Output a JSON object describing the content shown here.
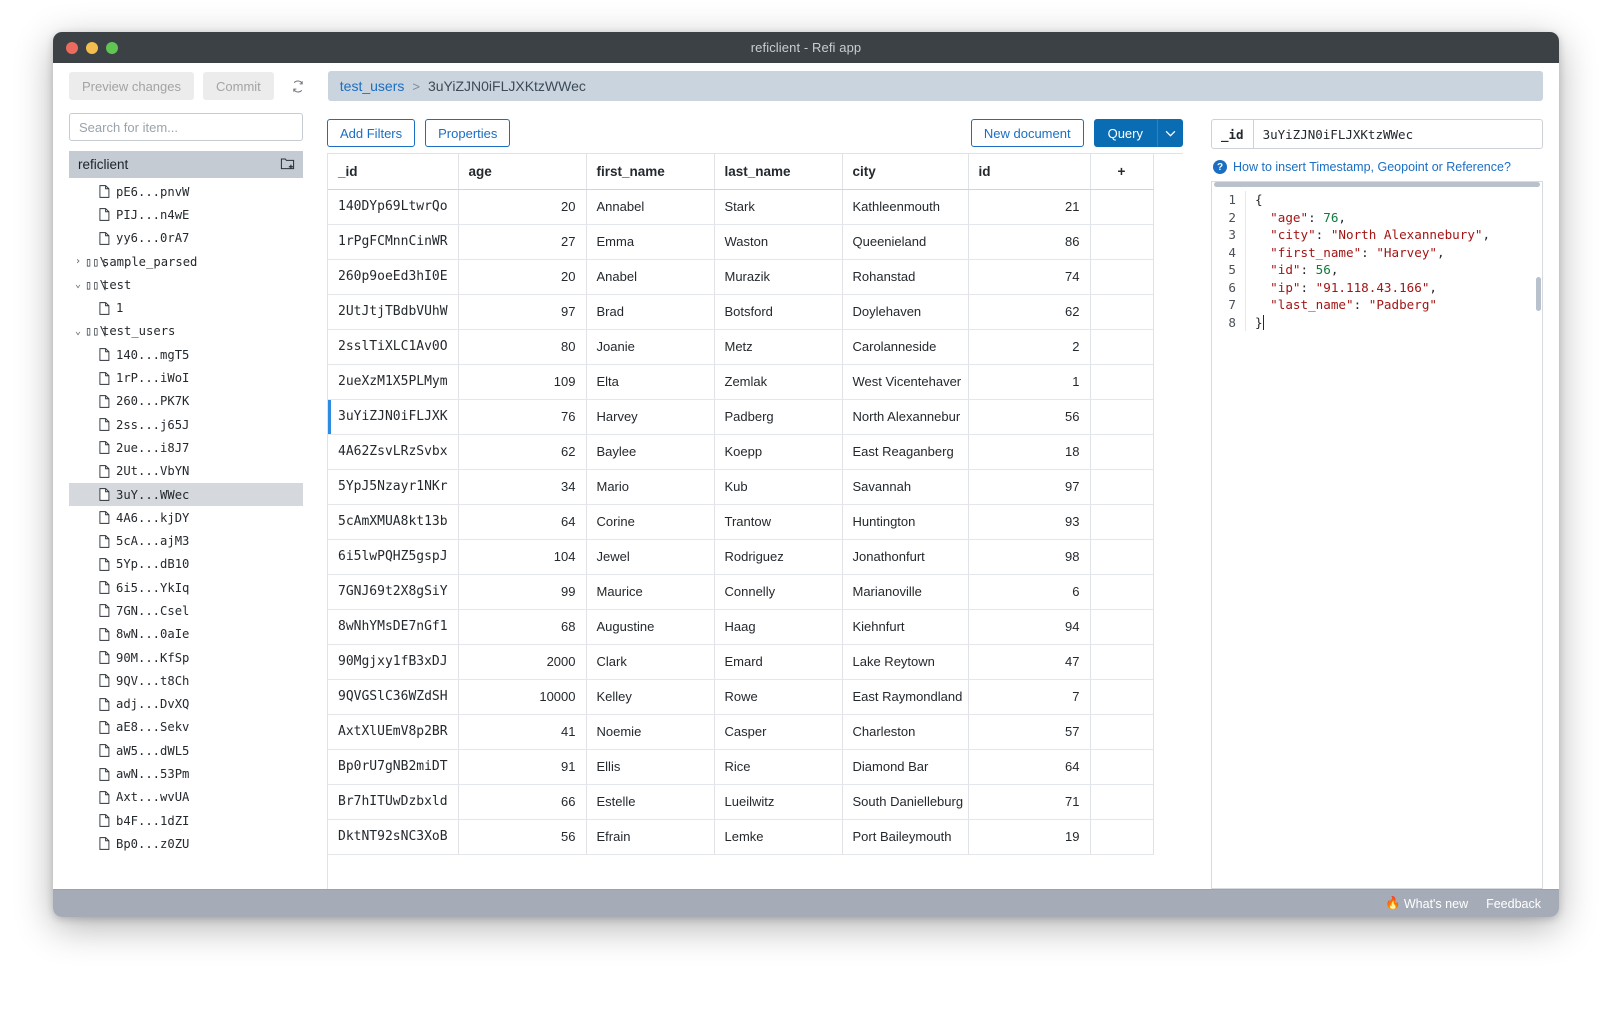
{
  "window": {
    "title": "reficlient - Refi app"
  },
  "toolbar": {
    "preview_changes_label": "Preview changes",
    "commit_label": "Commit",
    "refresh_icon": "refresh-icon",
    "breadcrumb": {
      "collection": "test_users",
      "separator": ">",
      "document": "3uYiZJN0iFLJXKtzWWec"
    }
  },
  "sidebar": {
    "search_placeholder": "Search for item...",
    "search_value": "",
    "header_label": "reficlient",
    "header_icon": "new-collection-icon",
    "items": [
      {
        "label": "pE6...pnvW",
        "type": "document",
        "indent": 1,
        "twisty": "",
        "selected": false
      },
      {
        "label": "PIJ...n4wE",
        "type": "document",
        "indent": 1,
        "twisty": "",
        "selected": false
      },
      {
        "label": "yy6...0rA7",
        "type": "document",
        "indent": 1,
        "twisty": "",
        "selected": false
      },
      {
        "label": "sample_parsed",
        "type": "collection",
        "indent": 0,
        "twisty": "collapsed",
        "selected": false
      },
      {
        "label": "test",
        "type": "collection",
        "indent": 0,
        "twisty": "expanded",
        "selected": false
      },
      {
        "label": "1",
        "type": "document",
        "indent": 1,
        "twisty": "",
        "selected": false
      },
      {
        "label": "test_users",
        "type": "collection",
        "indent": 0,
        "twisty": "expanded",
        "selected": false
      },
      {
        "label": "140...mgT5",
        "type": "document",
        "indent": 1,
        "twisty": "",
        "selected": false
      },
      {
        "label": "1rP...iWoI",
        "type": "document",
        "indent": 1,
        "twisty": "",
        "selected": false
      },
      {
        "label": "260...PK7K",
        "type": "document",
        "indent": 1,
        "twisty": "",
        "selected": false
      },
      {
        "label": "2ss...j65J",
        "type": "document",
        "indent": 1,
        "twisty": "",
        "selected": false
      },
      {
        "label": "2ue...i8J7",
        "type": "document",
        "indent": 1,
        "twisty": "",
        "selected": false
      },
      {
        "label": "2Ut...VbYN",
        "type": "document",
        "indent": 1,
        "twisty": "",
        "selected": false
      },
      {
        "label": "3uY...WWec",
        "type": "document",
        "indent": 1,
        "twisty": "",
        "selected": true
      },
      {
        "label": "4A6...kjDY",
        "type": "document",
        "indent": 1,
        "twisty": "",
        "selected": false
      },
      {
        "label": "5cA...ajM3",
        "type": "document",
        "indent": 1,
        "twisty": "",
        "selected": false
      },
      {
        "label": "5Yp...dB10",
        "type": "document",
        "indent": 1,
        "twisty": "",
        "selected": false
      },
      {
        "label": "6i5...YkIq",
        "type": "document",
        "indent": 1,
        "twisty": "",
        "selected": false
      },
      {
        "label": "7GN...Csel",
        "type": "document",
        "indent": 1,
        "twisty": "",
        "selected": false
      },
      {
        "label": "8wN...0aIe",
        "type": "document",
        "indent": 1,
        "twisty": "",
        "selected": false
      },
      {
        "label": "90M...KfSp",
        "type": "document",
        "indent": 1,
        "twisty": "",
        "selected": false
      },
      {
        "label": "9QV...t8Ch",
        "type": "document",
        "indent": 1,
        "twisty": "",
        "selected": false
      },
      {
        "label": "adj...DvXQ",
        "type": "document",
        "indent": 1,
        "twisty": "",
        "selected": false
      },
      {
        "label": "aE8...Sekv",
        "type": "document",
        "indent": 1,
        "twisty": "",
        "selected": false
      },
      {
        "label": "aW5...dWL5",
        "type": "document",
        "indent": 1,
        "twisty": "",
        "selected": false
      },
      {
        "label": "awN...53Pm",
        "type": "document",
        "indent": 1,
        "twisty": "",
        "selected": false
      },
      {
        "label": "Axt...wvUA",
        "type": "document",
        "indent": 1,
        "twisty": "",
        "selected": false
      },
      {
        "label": "b4F...1dZI",
        "type": "document",
        "indent": 1,
        "twisty": "",
        "selected": false
      },
      {
        "label": "Bp0...z0ZU",
        "type": "document",
        "indent": 1,
        "twisty": "",
        "selected": false
      }
    ]
  },
  "main": {
    "add_filters_label": "Add Filters",
    "properties_label": "Properties",
    "new_document_label": "New document",
    "query_label": "Query",
    "query_caret_icon": "chevron-down-icon",
    "add_column_icon": "plus-icon",
    "table": {
      "columns": [
        "_id",
        "age",
        "first_name",
        "last_name",
        "city",
        "id"
      ],
      "rows": [
        {
          "_id": "140DYp69LtwrQo",
          "age": "20",
          "first_name": "Annabel",
          "last_name": "Stark",
          "city": "Kathleenmouth",
          "id": "21",
          "selected": false
        },
        {
          "_id": "1rPgFCMnnCinWR",
          "age": "27",
          "first_name": "Emma",
          "last_name": "Waston",
          "city": "Queenieland",
          "id": "86",
          "selected": false
        },
        {
          "_id": "260p9oeEd3hI0E",
          "age": "20",
          "first_name": "Anabel",
          "last_name": "Murazik",
          "city": "Rohanstad",
          "id": "74",
          "selected": false
        },
        {
          "_id": "2UtJtjTBdbVUhW",
          "age": "97",
          "first_name": "Brad",
          "last_name": "Botsford",
          "city": "Doylehaven",
          "id": "62",
          "selected": false
        },
        {
          "_id": "2sslTiXLC1Av0O",
          "age": "80",
          "first_name": "Joanie",
          "last_name": "Metz",
          "city": "Carolanneside",
          "id": "2",
          "selected": false
        },
        {
          "_id": "2ueXzM1X5PLMym",
          "age": "109",
          "first_name": "Elta",
          "last_name": "Zemlak",
          "city": "West Vicentehaver",
          "id": "1",
          "selected": false
        },
        {
          "_id": "3uYiZJN0iFLJXK",
          "age": "76",
          "first_name": "Harvey",
          "last_name": "Padberg",
          "city": "North Alexannebur",
          "id": "56",
          "selected": true
        },
        {
          "_id": "4A62ZsvLRzSvbx",
          "age": "62",
          "first_name": "Baylee",
          "last_name": "Koepp",
          "city": "East Reaganberg",
          "id": "18",
          "selected": false
        },
        {
          "_id": "5YpJ5Nzayr1NKr",
          "age": "34",
          "first_name": "Mario",
          "last_name": "Kub",
          "city": "Savannah",
          "id": "97",
          "selected": false
        },
        {
          "_id": "5cAmXMUA8kt13b",
          "age": "64",
          "first_name": "Corine",
          "last_name": "Trantow",
          "city": "Huntington",
          "id": "93",
          "selected": false
        },
        {
          "_id": "6i5lwPQHZ5gspJ",
          "age": "104",
          "first_name": "Jewel",
          "last_name": "Rodriguez",
          "city": "Jonathonfurt",
          "id": "98",
          "selected": false
        },
        {
          "_id": "7GNJ69t2X8gSiY",
          "age": "99",
          "first_name": "Maurice",
          "last_name": "Connelly",
          "city": "Marianoville",
          "id": "6",
          "selected": false
        },
        {
          "_id": "8wNhYMsDE7nGf1",
          "age": "68",
          "first_name": "Augustine",
          "last_name": "Haag",
          "city": "Kiehnfurt",
          "id": "94",
          "selected": false
        },
        {
          "_id": "90Mgjxy1fB3xDJ",
          "age": "2000",
          "first_name": "Clark",
          "last_name": "Emard",
          "city": "Lake Reytown",
          "id": "47",
          "selected": false
        },
        {
          "_id": "9QVGSlC36WZdSH",
          "age": "10000",
          "first_name": "Kelley",
          "last_name": "Rowe",
          "city": "East Raymondland",
          "id": "7",
          "selected": false
        },
        {
          "_id": "AxtXlUEmV8p2BR",
          "age": "41",
          "first_name": "Noemie",
          "last_name": "Casper",
          "city": "Charleston",
          "id": "57",
          "selected": false
        },
        {
          "_id": "Bp0rU7gNB2miDT",
          "age": "91",
          "first_name": "Ellis",
          "last_name": "Rice",
          "city": "Diamond Bar",
          "id": "64",
          "selected": false
        },
        {
          "_id": "Br7hITUwDzbxld",
          "age": "66",
          "first_name": "Estelle",
          "last_name": "Lueilwitz",
          "city": "South Danielleburg",
          "id": "71",
          "selected": false
        },
        {
          "_id": "DktNT92sNC3XoB",
          "age": "56",
          "first_name": "Efrain",
          "last_name": "Lemke",
          "city": "Port Baileymouth",
          "id": "19",
          "selected": false
        }
      ]
    }
  },
  "inspector": {
    "id_label": "_id",
    "id_value": "3uYiZJN0iFLJXKtzWWec",
    "hint_icon": "question-mark-icon",
    "hint_text": "How to insert Timestamp, Geopoint or Reference?",
    "editor_lines": [
      {
        "num": "1",
        "segments": [
          {
            "t": "{",
            "c": "p"
          }
        ]
      },
      {
        "num": "2",
        "segments": [
          {
            "t": "  \"age\"",
            "c": "k"
          },
          {
            "t": ": ",
            "c": "p"
          },
          {
            "t": "76",
            "c": "n"
          },
          {
            "t": ",",
            "c": "p"
          }
        ]
      },
      {
        "num": "3",
        "segments": [
          {
            "t": "  \"city\"",
            "c": "k"
          },
          {
            "t": ": ",
            "c": "p"
          },
          {
            "t": "\"North Alexannebury\"",
            "c": "s"
          },
          {
            "t": ",",
            "c": "p"
          }
        ]
      },
      {
        "num": "4",
        "segments": [
          {
            "t": "  \"first_name\"",
            "c": "k"
          },
          {
            "t": ": ",
            "c": "p"
          },
          {
            "t": "\"Harvey\"",
            "c": "s"
          },
          {
            "t": ",",
            "c": "p"
          }
        ]
      },
      {
        "num": "5",
        "segments": [
          {
            "t": "  \"id\"",
            "c": "k"
          },
          {
            "t": ": ",
            "c": "p"
          },
          {
            "t": "56",
            "c": "n"
          },
          {
            "t": ",",
            "c": "p"
          }
        ]
      },
      {
        "num": "6",
        "segments": [
          {
            "t": "  \"ip\"",
            "c": "k"
          },
          {
            "t": ": ",
            "c": "p"
          },
          {
            "t": "\"91.118.43.166\"",
            "c": "s"
          },
          {
            "t": ",",
            "c": "p"
          }
        ]
      },
      {
        "num": "7",
        "segments": [
          {
            "t": "  \"last_name\"",
            "c": "k"
          },
          {
            "t": ": ",
            "c": "p"
          },
          {
            "t": "\"Padberg\"",
            "c": "s"
          }
        ]
      },
      {
        "num": "8",
        "segments": [
          {
            "t": "}",
            "c": "p"
          }
        ]
      }
    ]
  },
  "statusbar": {
    "whats_new_icon": "fire-icon",
    "whats_new_label": "What's new",
    "feedback_label": "Feedback"
  },
  "colors": {
    "accent": "#0a6cb3",
    "link": "#1b6ec2",
    "breadcrumb_bg": "#c9d4de",
    "titlebar_bg": "#3b4145",
    "statusbar_bg": "#a5acb8",
    "selection_bg": "#d5d9de",
    "row_select_marker": "#2d8ce0"
  }
}
